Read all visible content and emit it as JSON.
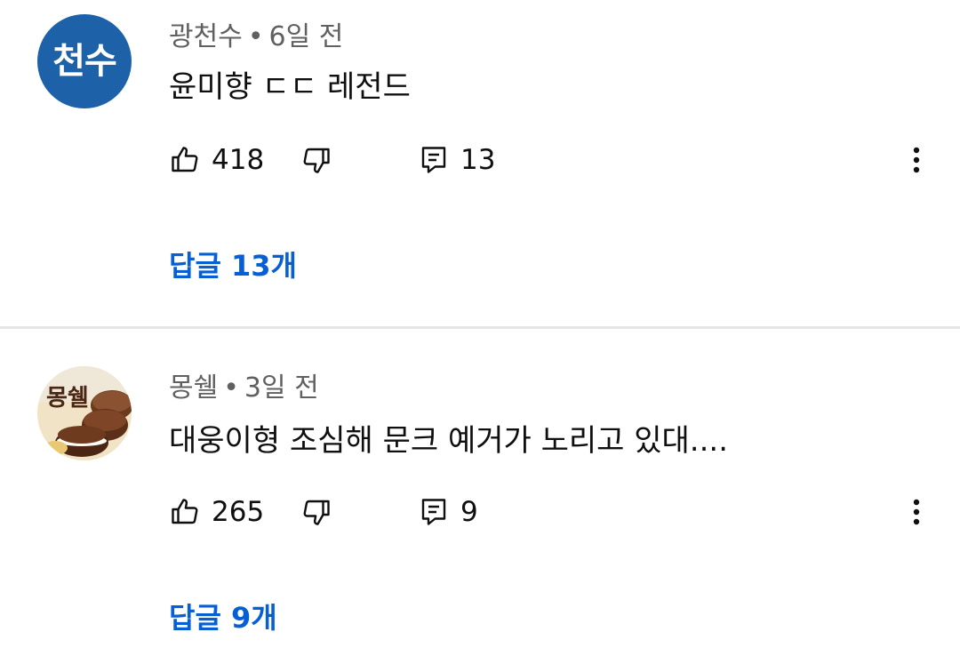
{
  "comments": [
    {
      "avatar_text": "천수",
      "avatar_color": "#1d62a8",
      "author": "광천수",
      "time": "6일 전",
      "text": "윤미향 ㄷㄷ 레전드",
      "likes": "418",
      "reply_count": "13",
      "replies_link": "답글 13개"
    },
    {
      "avatar_text": "몽쉘",
      "author": "몽쉘",
      "time": "3일 전",
      "text": "대웅이형 조심해 문크 예거가 노리고 있대....",
      "likes": "265",
      "reply_count": "9",
      "replies_link": "답글 9개"
    }
  ],
  "icons": {
    "like": "thumb-up-icon",
    "dislike": "thumb-down-icon",
    "reply": "comment-icon",
    "more": "more-vert-icon"
  },
  "colors": {
    "link": "#065fd4",
    "meta": "#606060",
    "divider": "#e5e5e5"
  },
  "separator": "•"
}
